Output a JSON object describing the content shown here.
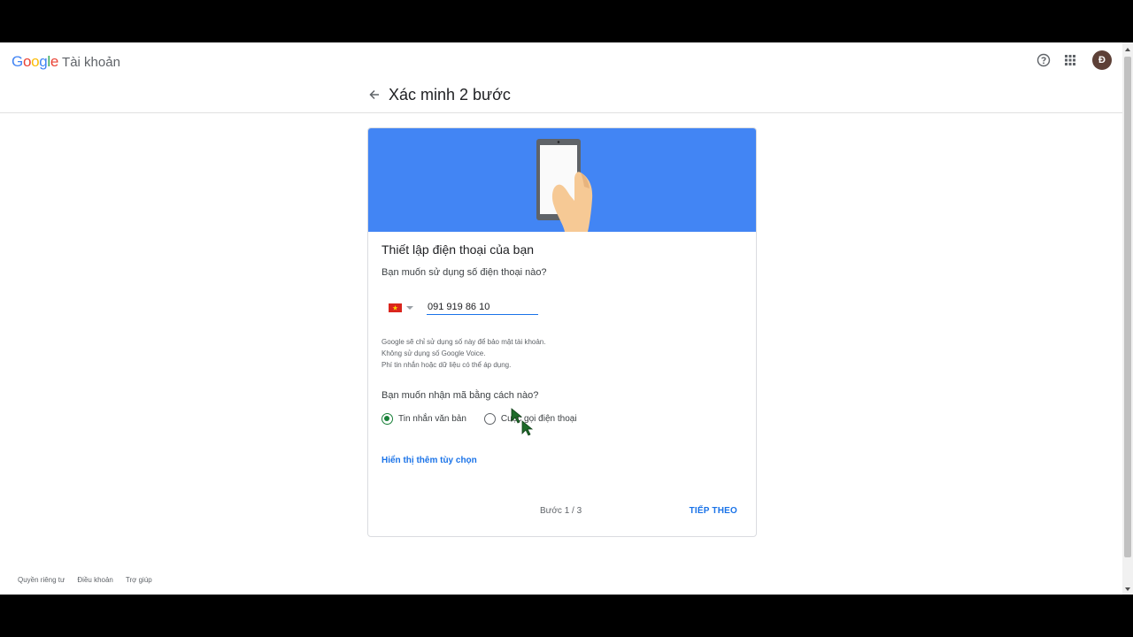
{
  "header": {
    "logo_text": "Google",
    "product": "Tài khoản",
    "avatar_initial": "Đ",
    "help_icon": "help-circle-icon",
    "apps_icon": "apps-grid-icon"
  },
  "page": {
    "title": "Xác minh 2 bước"
  },
  "card": {
    "heading": "Thiết lập điện thoại của bạn",
    "phone_question": "Bạn muốn sử dụng số điện thoại nào?",
    "country_flag": "vietnam-flag-icon",
    "phone_value": "091 919 86 10",
    "notes": [
      "Google sẽ chỉ sử dụng số này để bảo mật tài khoản.",
      "Không sử dụng số Google Voice.",
      "Phí tin nhắn hoặc dữ liệu có thể áp dụng."
    ],
    "method_question": "Bạn muốn nhận mã bằng cách nào?",
    "options": [
      {
        "label": "Tin nhắn văn bản",
        "selected": true
      },
      {
        "label": "Cuộc gọi điện thoại",
        "selected": false
      }
    ],
    "more_options": "Hiển thị thêm tùy chọn",
    "step": "Bước 1 / 3",
    "next": "TIẾP THEO"
  },
  "footer": {
    "privacy": "Quyền riêng tư",
    "terms": "Điều khoản",
    "help": "Trợ giúp"
  },
  "colors": {
    "hero": "#4285f4",
    "link": "#1a73e8",
    "radio_on": "#188038"
  }
}
